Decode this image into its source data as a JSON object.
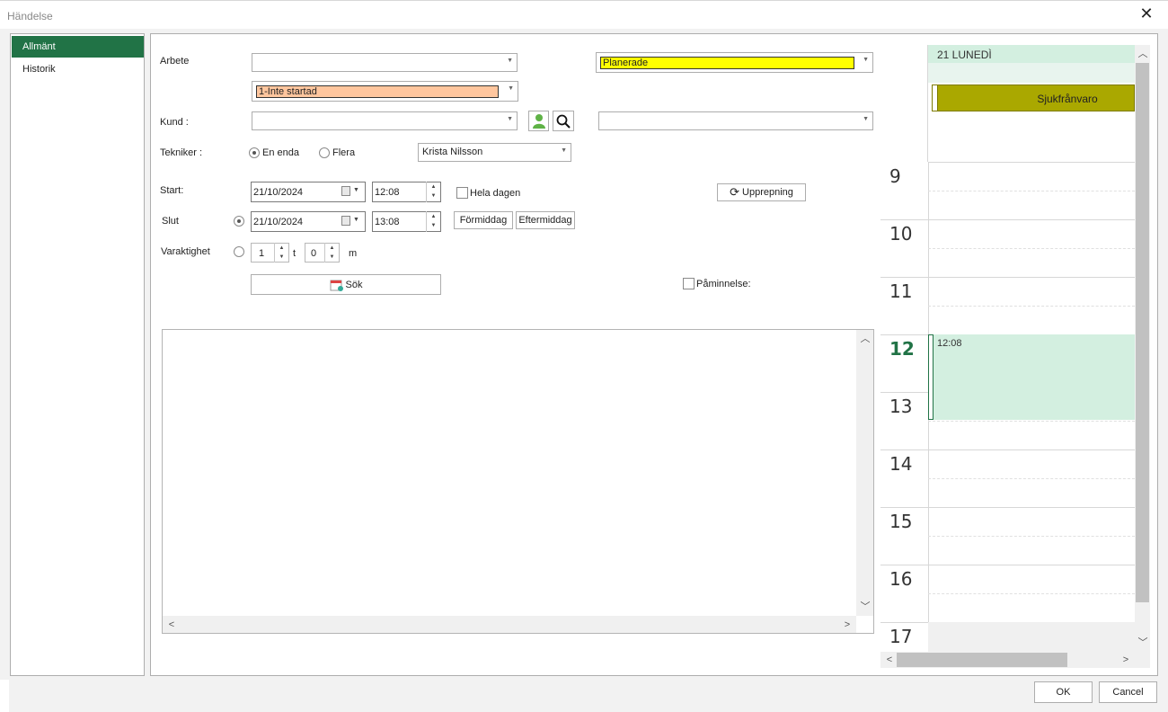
{
  "window": {
    "title": "Händelse",
    "close_icon": "close-icon"
  },
  "nav": {
    "items": [
      {
        "label": "Allmänt",
        "active": true
      },
      {
        "label": "Historik",
        "active": false
      }
    ]
  },
  "form": {
    "arbete_label": "Arbete",
    "arbete_value": "",
    "status_value": "Planerade",
    "status_color": "#ffff00",
    "progress_value": "1-Inte startad",
    "progress_color": "#ffc69e",
    "kund_label": "Kund :",
    "kund_value": "",
    "kund_contact_value": "",
    "tekniker_label": "Tekniker :",
    "tekniker_single": "En enda",
    "tekniker_multi": "Flera",
    "tekniker_value": "Krista Nilsson",
    "start_label": "Start:",
    "start_date": "21/10/2024",
    "start_time": "12:08",
    "hela_dagen": "Hela dagen",
    "upprepning": "Upprepning",
    "slut_label": "Slut",
    "slut_date": "21/10/2024",
    "slut_time": "13:08",
    "formiddag": "Förmiddag",
    "eftermiddag": "Eftermiddag",
    "varaktighet_label": "Varaktighet",
    "hours_value": "1",
    "hours_unit": "t",
    "minutes_value": "0",
    "minutes_unit": "m",
    "sok": "Sök",
    "paminnelse": "Påminnelse:"
  },
  "calendar": {
    "day_header": "21 LUNEDÌ",
    "all_day_event": "Sjukfrånvaro",
    "all_day_event_color": "#aaa800",
    "hours": [
      "9",
      "10",
      "11",
      "12",
      "13",
      "14",
      "15",
      "16",
      "17"
    ],
    "current_hour": "12",
    "current_hour_color": "#217346",
    "event_time": "12:08",
    "event_color": "#d3efe0"
  },
  "footer": {
    "ok": "OK",
    "cancel": "Cancel"
  }
}
